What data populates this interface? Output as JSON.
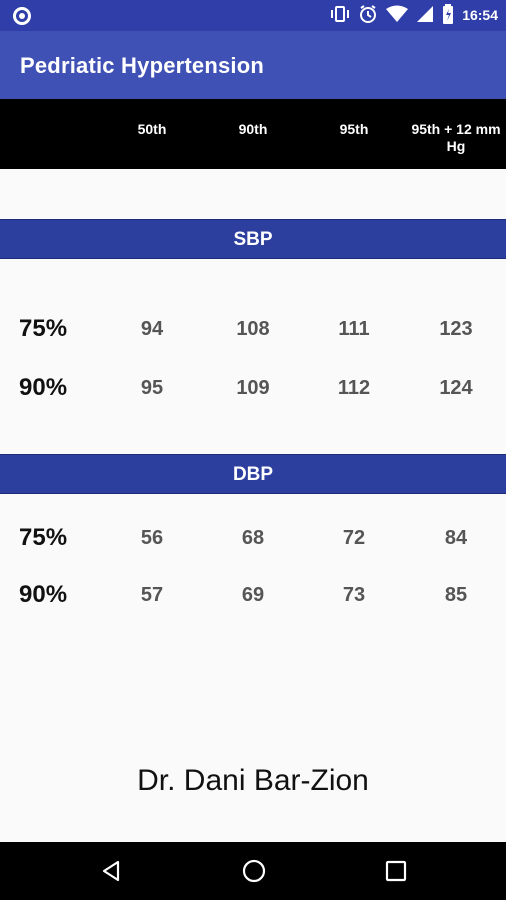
{
  "statusbar": {
    "time": "16:54",
    "icons": [
      "vibrate-icon",
      "alarm-icon",
      "wifi-icon",
      "signal-icon",
      "battery-icon"
    ]
  },
  "appbar": {
    "title": "Pedriatic Hypertension"
  },
  "header": {
    "columns": [
      "50th",
      "90th",
      "95th",
      "95th + 12 mm Hg"
    ]
  },
  "sections": [
    {
      "label": "SBP",
      "rows": [
        {
          "percentile": "75%",
          "values": [
            "94",
            "108",
            "111",
            "123"
          ]
        },
        {
          "percentile": "90%",
          "values": [
            "95",
            "109",
            "112",
            "124"
          ]
        }
      ]
    },
    {
      "label": "DBP",
      "rows": [
        {
          "percentile": "75%",
          "values": [
            "56",
            "68",
            "72",
            "84"
          ]
        },
        {
          "percentile": "90%",
          "values": [
            "57",
            "69",
            "73",
            "85"
          ]
        }
      ]
    }
  ],
  "author": "Dr. Dani Bar-Zion",
  "colors": {
    "statusbar": "#2f3ea8",
    "appbar": "#3f51b5",
    "section_bar": "#2c3e9e",
    "header": "#000000"
  }
}
